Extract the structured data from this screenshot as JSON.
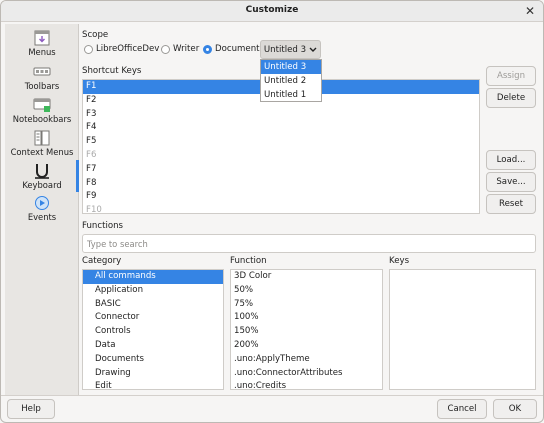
{
  "window": {
    "title": "Customize"
  },
  "sidebar": {
    "items": [
      {
        "label": "Menus",
        "icon": "menus-icon"
      },
      {
        "label": "Toolbars",
        "icon": "toolbars-icon"
      },
      {
        "label": "Notebookbars",
        "icon": "notebookbars-icon"
      },
      {
        "label": "Context Menus",
        "icon": "context-menus-icon"
      },
      {
        "label": "Keyboard",
        "icon": "keyboard-icon",
        "active": true
      },
      {
        "label": "Events",
        "icon": "events-icon"
      }
    ]
  },
  "scope": {
    "label": "Scope",
    "options": [
      "LibreOfficeDev",
      "Writer",
      "Document"
    ],
    "selected": "Document",
    "document_combo": {
      "value": "Untitled 3",
      "options": [
        "Untitled 3",
        "Untitled 2",
        "Untitled 1"
      ]
    }
  },
  "shortcut_keys": {
    "label": "Shortcut Keys",
    "rows": [
      {
        "key": "F1",
        "state": "selected"
      },
      {
        "key": "F2",
        "state": ""
      },
      {
        "key": "F3",
        "state": ""
      },
      {
        "key": "F4",
        "state": ""
      },
      {
        "key": "F5",
        "state": ""
      },
      {
        "key": "F6",
        "state": "dim"
      },
      {
        "key": "F7",
        "state": ""
      },
      {
        "key": "F8",
        "state": ""
      },
      {
        "key": "F9",
        "state": ""
      },
      {
        "key": "F10",
        "state": "dim"
      }
    ]
  },
  "buttons": {
    "assign": "Assign",
    "delete": "Delete",
    "load": "Load...",
    "save": "Save...",
    "reset": "Reset",
    "help": "Help",
    "cancel": "Cancel",
    "ok": "OK"
  },
  "functions": {
    "label": "Functions",
    "search_placeholder": "Type to search",
    "category_label": "Category",
    "function_label": "Function",
    "keys_label": "Keys",
    "categories": [
      "All commands",
      "Application",
      "BASIC",
      "Connector",
      "Controls",
      "Data",
      "Documents",
      "Drawing",
      "Edit"
    ],
    "functions": [
      "3D Color",
      "50%",
      "75%",
      "100%",
      "150%",
      "200%",
      ".uno:ApplyTheme",
      ".uno:ConnectorAttributes",
      ".uno:Credits"
    ]
  },
  "colors": {
    "accent": "#3584e4"
  }
}
